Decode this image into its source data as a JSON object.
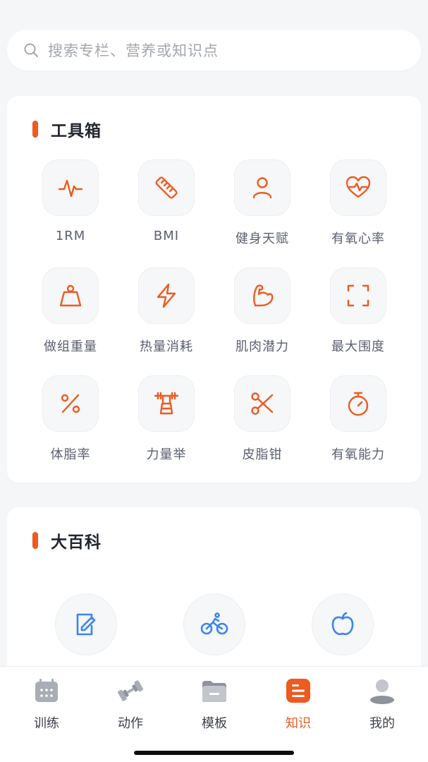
{
  "search": {
    "placeholder": "搜索专栏、营养或知识点"
  },
  "toolbox": {
    "title": "工具箱",
    "items": [
      {
        "label": "1RM",
        "icon": "pulse-icon"
      },
      {
        "label": "BMI",
        "icon": "ruler-icon"
      },
      {
        "label": "健身天赋",
        "icon": "person-icon"
      },
      {
        "label": "有氧心率",
        "icon": "heart-rate-icon"
      },
      {
        "label": "做组重量",
        "icon": "weight-icon"
      },
      {
        "label": "热量消耗",
        "icon": "lightning-icon"
      },
      {
        "label": "肌肉潜力",
        "icon": "bicep-icon"
      },
      {
        "label": "最大围度",
        "icon": "scan-frame-icon"
      },
      {
        "label": "体脂率",
        "icon": "percent-icon"
      },
      {
        "label": "力量举",
        "icon": "barbell-icon"
      },
      {
        "label": "皮脂钳",
        "icon": "scissors-icon"
      },
      {
        "label": "有氧能力",
        "icon": "stopwatch-icon"
      }
    ]
  },
  "encyclopedia": {
    "title": "大百科",
    "items": [
      {
        "icon": "document-edit-icon"
      },
      {
        "icon": "bicycle-icon"
      },
      {
        "icon": "apple-icon"
      }
    ]
  },
  "tabbar": {
    "tabs": [
      {
        "label": "训练",
        "icon": "calendar-icon",
        "active": false
      },
      {
        "label": "动作",
        "icon": "dumbbell-icon",
        "active": false
      },
      {
        "label": "模板",
        "icon": "folder-icon",
        "active": false
      },
      {
        "label": "知识",
        "icon": "knowledge-doc-icon",
        "active": true
      },
      {
        "label": "我的",
        "icon": "profile-icon",
        "active": false
      }
    ]
  },
  "colors": {
    "accent": "#ee5a1f",
    "wiki_icon": "#3a85f0",
    "tab_inactive_icon": "#a9adb6",
    "background": "#f5f6f8"
  }
}
